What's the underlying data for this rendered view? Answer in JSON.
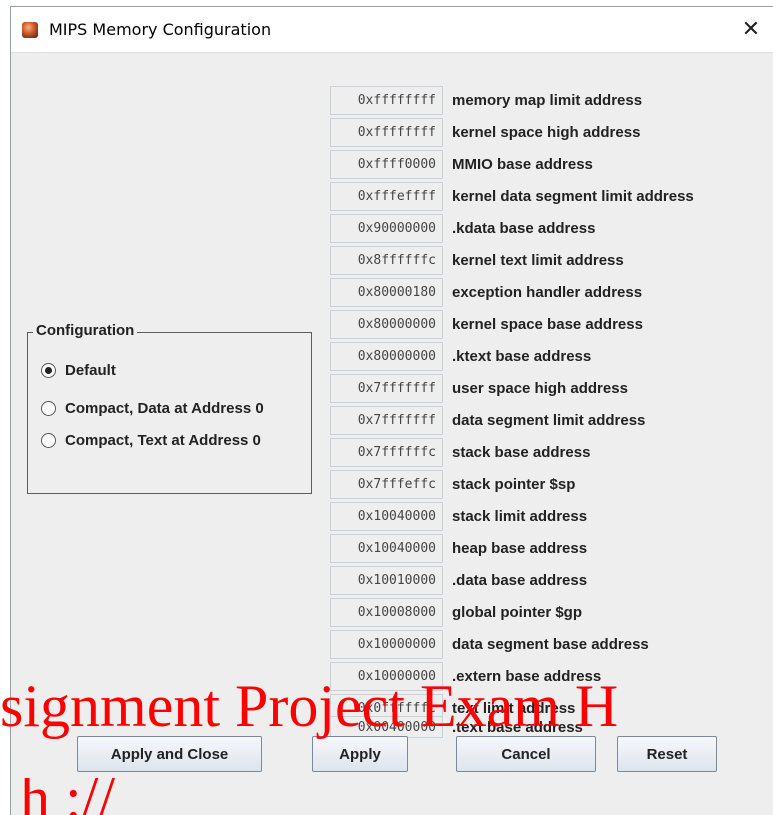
{
  "window": {
    "title": "MIPS Memory Configuration",
    "close_glyph": "✕"
  },
  "configuration": {
    "legend": "Configuration",
    "options": [
      {
        "label": "Default",
        "selected": true
      },
      {
        "label": "Compact, Data at Address 0",
        "selected": false
      },
      {
        "label": "Compact, Text at Address 0",
        "selected": false
      }
    ]
  },
  "addresses": [
    {
      "value": "0xffffffff",
      "label": "memory map limit address"
    },
    {
      "value": "0xffffffff",
      "label": "kernel space high address"
    },
    {
      "value": "0xffff0000",
      "label": "MMIO base address"
    },
    {
      "value": "0xfffeffff",
      "label": "kernel data segment limit address"
    },
    {
      "value": "0x90000000",
      "label": ".kdata base address"
    },
    {
      "value": "0x8ffffffc",
      "label": "kernel text limit address"
    },
    {
      "value": "0x80000180",
      "label": "exception handler address"
    },
    {
      "value": "0x80000000",
      "label": "kernel space base address"
    },
    {
      "value": "0x80000000",
      "label": ".ktext base address"
    },
    {
      "value": "0x7fffffff",
      "label": "user space high address"
    },
    {
      "value": "0x7fffffff",
      "label": "data segment limit address"
    },
    {
      "value": "0x7ffffffc",
      "label": "stack base address"
    },
    {
      "value": "0x7fffeffc",
      "label": "stack pointer $sp"
    },
    {
      "value": "0x10040000",
      "label": "stack limit address"
    },
    {
      "value": "0x10040000",
      "label": "heap base address"
    },
    {
      "value": "0x10010000",
      "label": ".data base address"
    },
    {
      "value": "0x10008000",
      "label": "global pointer $gp"
    },
    {
      "value": "0x10000000",
      "label": "data segment base address"
    },
    {
      "value": "0x10000000",
      "label": ".extern base address"
    },
    {
      "value": "0x0ffffffc",
      "label": "text limit address"
    },
    {
      "value": "0x00400000",
      "label": ".text base address"
    }
  ],
  "buttons": {
    "apply_close": "Apply and Close",
    "apply": "Apply",
    "cancel": "Cancel",
    "reset": "Reset"
  },
  "watermark": {
    "line1": "signment Project Exam H",
    "line2": "h   ://"
  },
  "colors": {
    "watermark": "#ff0000",
    "window_bg": "#eeeeee"
  }
}
